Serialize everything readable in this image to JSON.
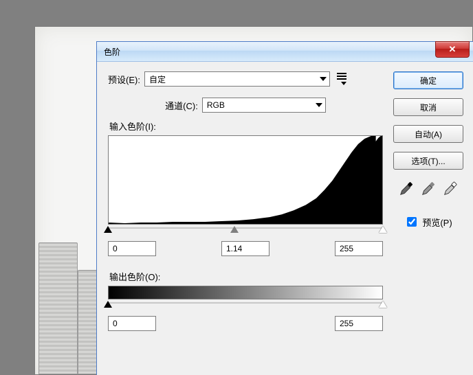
{
  "dialog": {
    "title": "色阶",
    "close_glyph": "✕",
    "preset_label": "预设(E):",
    "preset_value": "自定",
    "channel_label": "通道(C):",
    "channel_value": "RGB",
    "input_levels_label": "输入色阶(I):",
    "output_levels_label": "输出色阶(O):",
    "shadow_value": "0",
    "gamma_value": "1.14",
    "highlight_value": "255",
    "out_shadow_value": "0",
    "out_highlight_value": "255"
  },
  "buttons": {
    "ok": "确定",
    "cancel": "取消",
    "auto": "自动(A)",
    "options": "选项(T)...",
    "preview": "预览(P)"
  },
  "colors": {
    "accent": "#2a72c8",
    "panel": "#f0f0f0"
  }
}
